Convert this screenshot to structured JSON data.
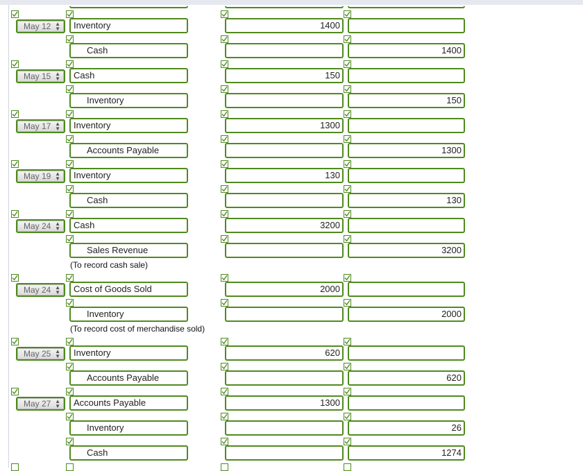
{
  "entries": [
    {
      "date": "May 12",
      "rows": [
        {
          "account": "Inventory",
          "debit": "1400",
          "credit": "",
          "indent": false
        },
        {
          "account": "Cash",
          "debit": "",
          "credit": "1400",
          "indent": true
        }
      ],
      "note": ""
    },
    {
      "date": "May 15",
      "rows": [
        {
          "account": "Cash",
          "debit": "150",
          "credit": "",
          "indent": false
        },
        {
          "account": "Inventory",
          "debit": "",
          "credit": "150",
          "indent": true
        }
      ],
      "note": ""
    },
    {
      "date": "May 17",
      "rows": [
        {
          "account": "Inventory",
          "debit": "1300",
          "credit": "",
          "indent": false
        },
        {
          "account": "Accounts Payable",
          "debit": "",
          "credit": "1300",
          "indent": true
        }
      ],
      "note": ""
    },
    {
      "date": "May 19",
      "rows": [
        {
          "account": "Inventory",
          "debit": "130",
          "credit": "",
          "indent": false
        },
        {
          "account": "Cash",
          "debit": "",
          "credit": "130",
          "indent": true
        }
      ],
      "note": ""
    },
    {
      "date": "May 24",
      "rows": [
        {
          "account": "Cash",
          "debit": "3200",
          "credit": "",
          "indent": false
        },
        {
          "account": "Sales Revenue",
          "debit": "",
          "credit": "3200",
          "indent": true
        }
      ],
      "note": "(To record cash sale)"
    },
    {
      "date": "May 24",
      "rows": [
        {
          "account": "Cost of Goods Sold",
          "debit": "2000",
          "credit": "",
          "indent": false
        },
        {
          "account": "Inventory",
          "debit": "",
          "credit": "2000",
          "indent": true
        }
      ],
      "note": "(To record cost of merchandise sold)"
    },
    {
      "date": "May 25",
      "rows": [
        {
          "account": "Inventory",
          "debit": "620",
          "credit": "",
          "indent": false
        },
        {
          "account": "Accounts Payable",
          "debit": "",
          "credit": "620",
          "indent": true
        }
      ],
      "note": ""
    },
    {
      "date": "May 27",
      "rows": [
        {
          "account": "Accounts Payable",
          "debit": "1300",
          "credit": "",
          "indent": false
        },
        {
          "account": "Inventory",
          "debit": "",
          "credit": "26",
          "indent": true
        },
        {
          "account": "Cash",
          "debit": "",
          "credit": "1274",
          "indent": true
        }
      ],
      "note": ""
    }
  ],
  "colors": {
    "border": "#4f8a1e",
    "check": "#4f8a1e"
  },
  "icons": {
    "check": "check-icon",
    "date_arrows": "up-down-arrow-icon"
  }
}
